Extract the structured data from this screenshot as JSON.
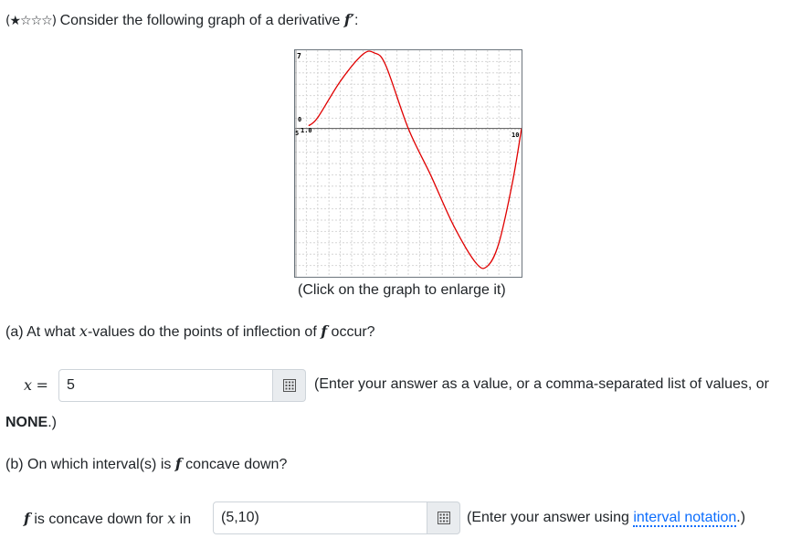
{
  "problem": {
    "stars": "(★☆☆☆)",
    "intro_prefix": " Consider the following graph of a derivative ",
    "intro_fn": "f′",
    "intro_suffix": ":"
  },
  "graph": {
    "caption": "(Click on the graph to enlarge it)",
    "y_top_label": "7",
    "y_mid_label": "0",
    "origin_label": "5",
    "x_tick_label": "1.0",
    "x_end_label": "10",
    "curve_color": "#e00000",
    "chart_data": {
      "type": "line",
      "x": [
        0.6,
        1.0,
        2.0,
        3.0,
        3.5,
        4.0,
        5.0,
        6.0,
        7.0,
        8.0,
        8.5,
        9.0,
        9.6,
        10.0
      ],
      "y": [
        0.2,
        0.8,
        3.5,
        5.5,
        5.6,
        4.7,
        0.0,
        -3.5,
        -7.2,
        -10.0,
        -10.2,
        -8.5,
        -4.0,
        0.0
      ],
      "xlim": [
        0,
        10
      ],
      "ylim": [
        -11,
        5.8
      ]
    }
  },
  "part_a": {
    "question_prefix": "(a) At what ",
    "question_var": "x",
    "question_middle": "-values do the points of inflection of ",
    "question_fn": "f",
    "question_suffix": " occur?",
    "lhs_var": "x",
    "lhs_eq": "=",
    "input_value": "5",
    "hint": "(Enter your answer as a value, or a comma-separated list of values, or",
    "hint_cont_bold": "NONE",
    "hint_cont_end": ".)"
  },
  "part_b": {
    "question_prefix": "(b) On which interval(s) is ",
    "question_fn": "f",
    "question_suffix": " concave down?",
    "lhs_fn": "f",
    "lhs_text": " is concave down for ",
    "lhs_var": "x",
    "lhs_in": " in",
    "input_value": "(5,10)",
    "hint_prefix": "(Enter your answer using ",
    "hint_link": "interval notation",
    "hint_suffix": ".)"
  }
}
